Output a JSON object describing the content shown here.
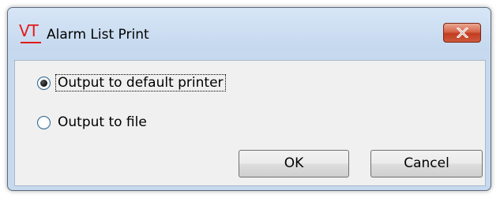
{
  "window": {
    "title": "Alarm List Print",
    "logo_text": "VT"
  },
  "options": [
    {
      "label": "Output to default printer",
      "selected": true
    },
    {
      "label": "Output to file",
      "selected": false
    }
  ],
  "buttons": {
    "ok_label": "OK",
    "cancel_label": "Cancel"
  },
  "icons": {
    "app": "vt-logo-icon",
    "close": "close-icon"
  },
  "colors": {
    "titlebar": "#c6d9ee",
    "close_button": "#c7432a",
    "logo": "#e21b1b"
  }
}
